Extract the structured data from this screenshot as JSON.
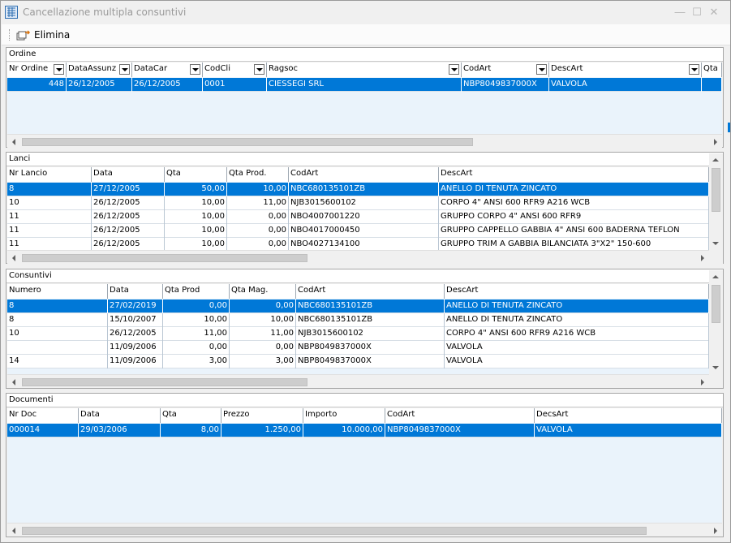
{
  "window": {
    "title": "Cancellazione multipla consuntivi"
  },
  "toolbar": {
    "elimina_label": "Elimina"
  },
  "ordine": {
    "title": "Ordine",
    "columns": [
      "Nr Ordine",
      "DataAssunz",
      "DataCar",
      "CodCli",
      "Ragsoc",
      "CodArt",
      "DescArt",
      "Qta"
    ],
    "rows": [
      [
        "448",
        "26/12/2005",
        "26/12/2005",
        "0001",
        "CIESSEGI SRL",
        "NBP8049837000X",
        "VALVOLA",
        ""
      ]
    ]
  },
  "lanci": {
    "title": "Lanci",
    "columns": [
      "Nr Lancio",
      "Data",
      "Qta",
      "Qta Prod.",
      "CodArt",
      "DescArt"
    ],
    "rows": [
      [
        "8",
        "27/12/2005",
        "50,00",
        "10,00",
        "NBC680135101ZB",
        "ANELLO DI TENUTA ZINCATO"
      ],
      [
        "10",
        "26/12/2005",
        "10,00",
        "11,00",
        "NJB3015600102",
        "CORPO 4\" ANSI 600 RFR9 A216 WCB"
      ],
      [
        "11",
        "26/12/2005",
        "10,00",
        "0,00",
        "NBO4007001220",
        "GRUPPO CORPO 4\" ANSI 600 RFR9"
      ],
      [
        "11",
        "26/12/2005",
        "10,00",
        "0,00",
        "NBO4017000450",
        "GRUPPO CAPPELLO GABBIA 4\" ANSI 600 BADERNA TEFLON"
      ],
      [
        "11",
        "26/12/2005",
        "10,00",
        "0,00",
        "NBO4027134100",
        "GRUPPO TRIM A GABBIA BILANCIATA 3\"X2\" 150-600"
      ]
    ]
  },
  "consuntivi": {
    "title": "Consuntivi",
    "columns": [
      "Numero",
      "Data",
      "Qta Prod",
      "Qta Mag.",
      "CodArt",
      "DescArt"
    ],
    "rows": [
      [
        "8",
        "27/02/2019",
        "0,00",
        "0,00",
        "NBC680135101ZB",
        "ANELLO DI TENUTA ZINCATO"
      ],
      [
        "8",
        "15/10/2007",
        "10,00",
        "10,00",
        "NBC680135101ZB",
        "ANELLO DI TENUTA ZINCATO"
      ],
      [
        "10",
        "26/12/2005",
        "11,00",
        "11,00",
        "NJB3015600102",
        "CORPO 4\" ANSI 600 RFR9 A216 WCB"
      ],
      [
        "",
        "11/09/2006",
        "0,00",
        "0,00",
        "NBP8049837000X",
        "VALVOLA"
      ],
      [
        "14",
        "11/09/2006",
        "3,00",
        "3,00",
        "NBP8049837000X",
        "VALVOLA"
      ]
    ]
  },
  "documenti": {
    "title": "Documenti",
    "columns": [
      "Nr Doc",
      "Data",
      "Qta",
      "Prezzo",
      "Importo",
      "CodArt",
      "DecsArt"
    ],
    "rows": [
      [
        "000014",
        "29/03/2006",
        "8,00",
        "1.250,00",
        "10.000,00",
        "NBP8049837000X",
        "VALVOLA"
      ]
    ]
  }
}
